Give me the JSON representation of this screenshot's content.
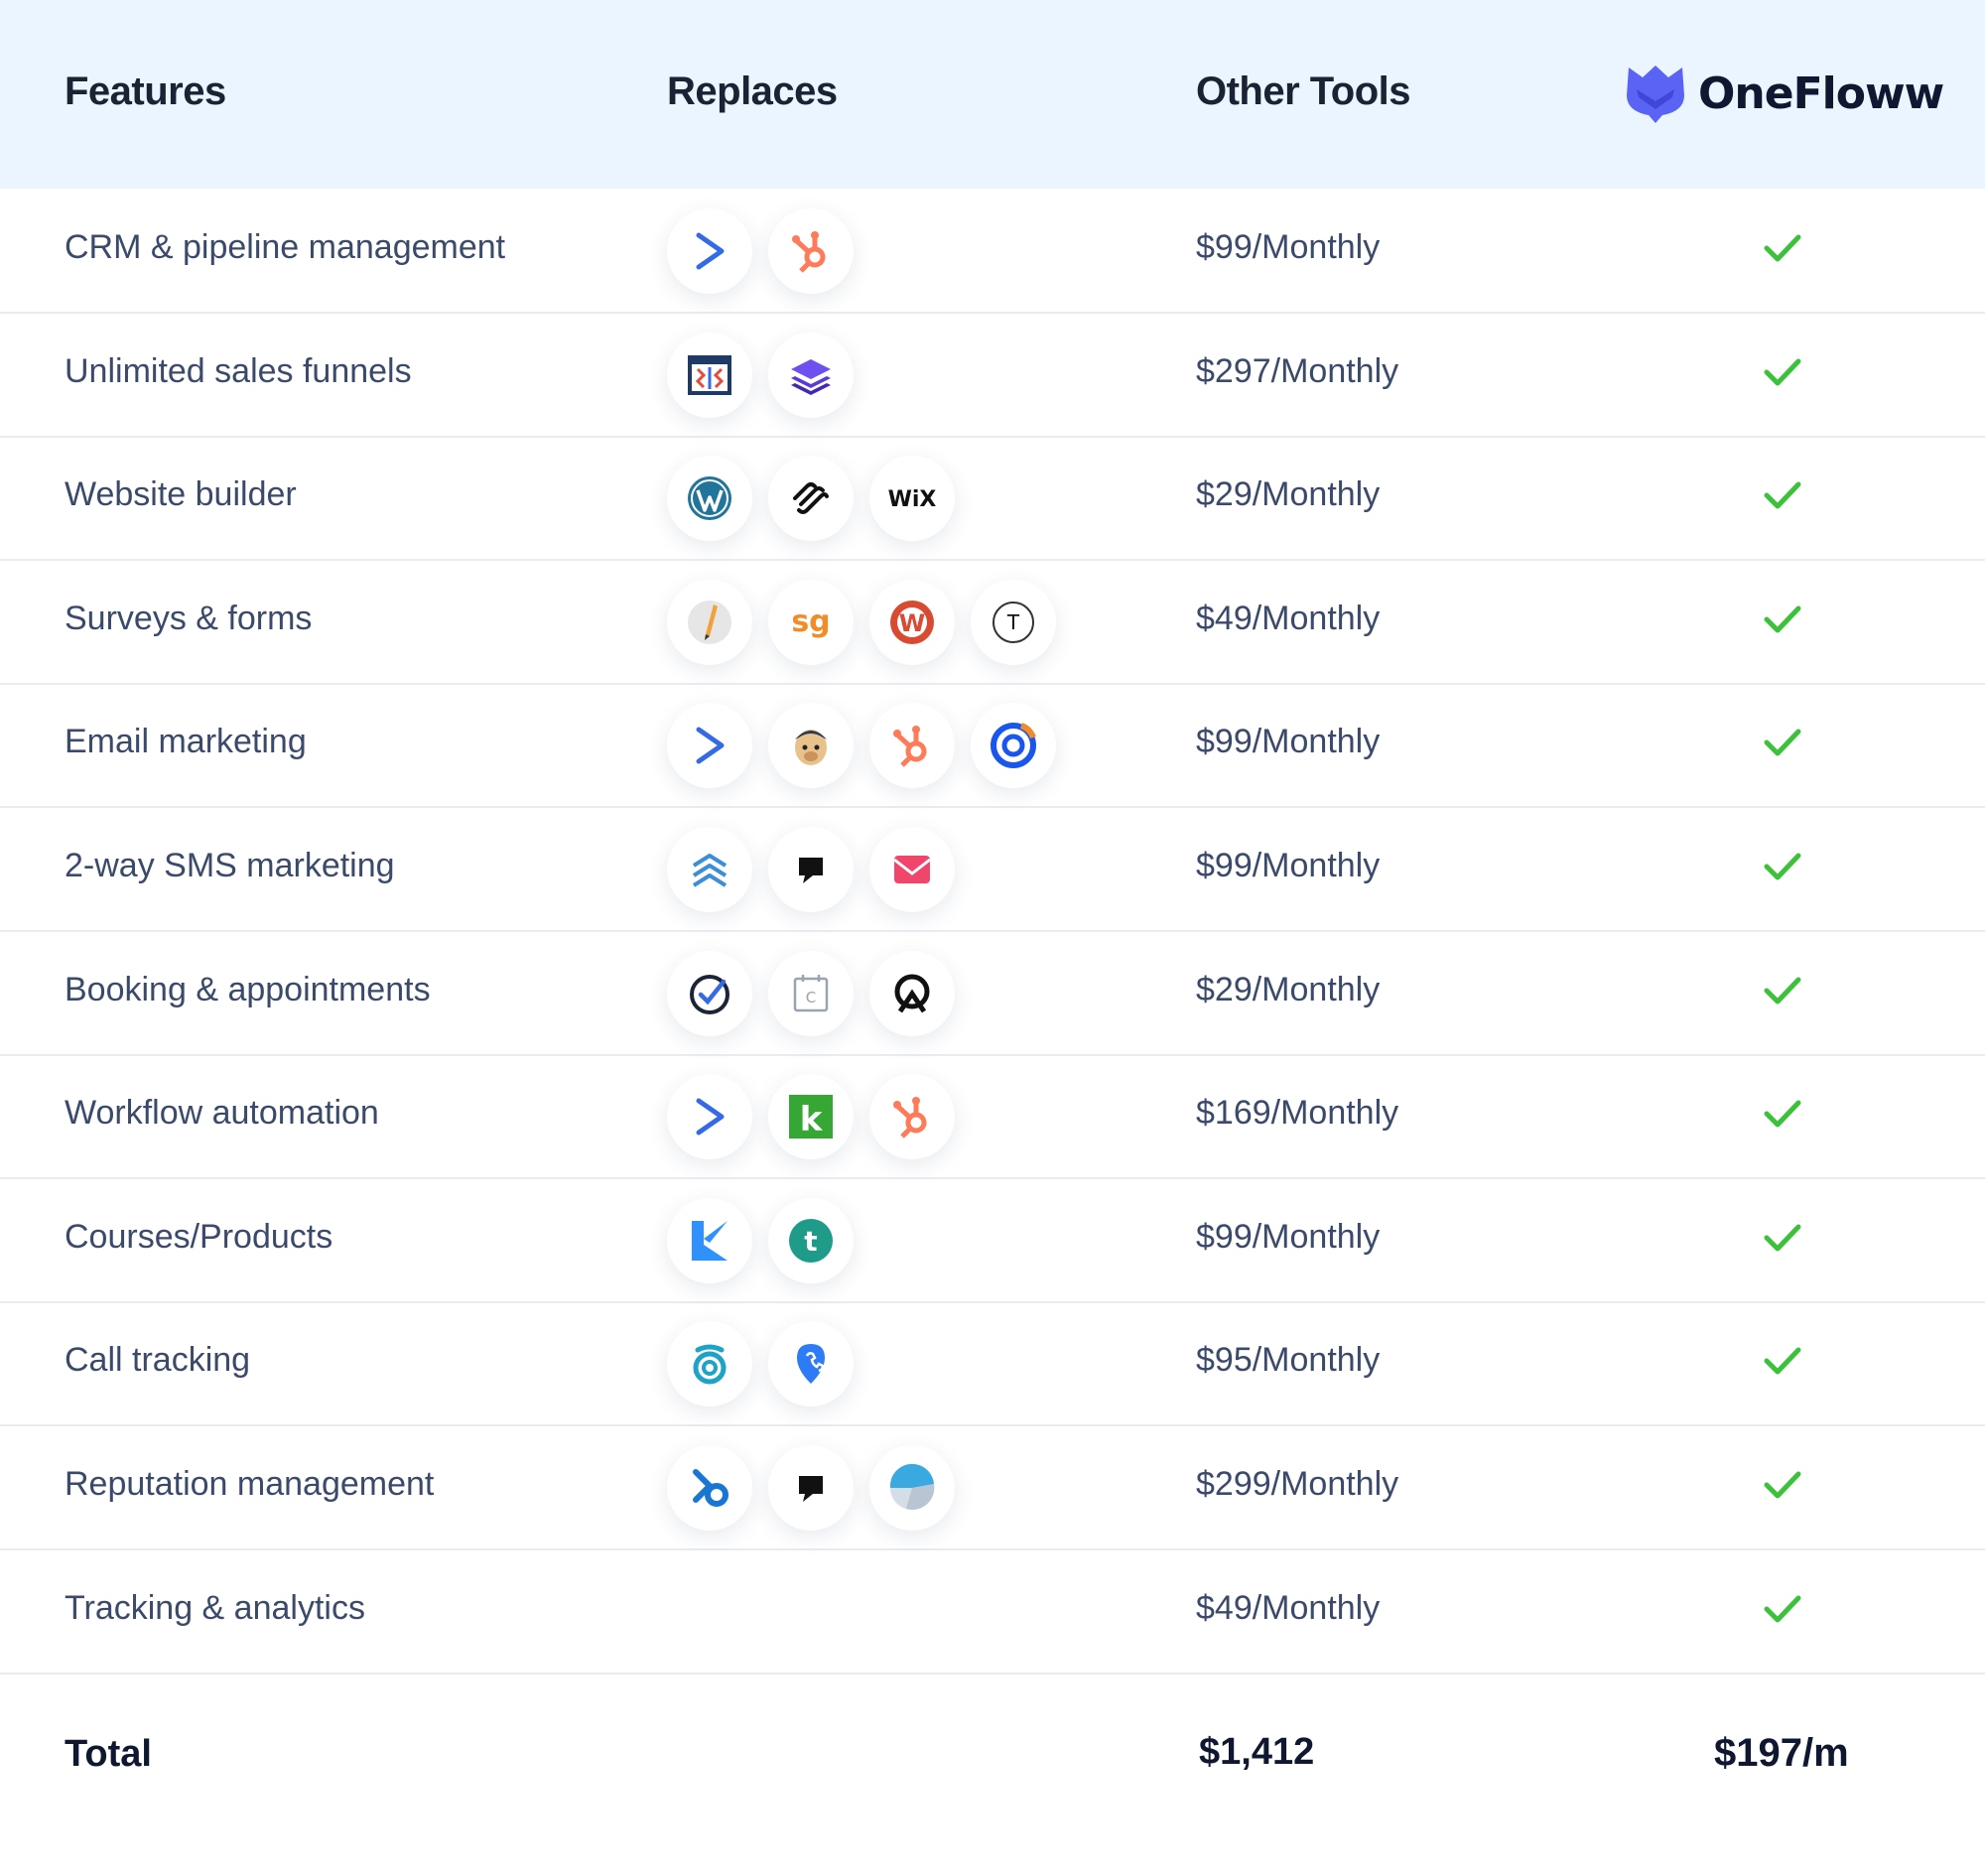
{
  "header": {
    "features": "Features",
    "replaces": "Replaces",
    "other_tools": "Other Tools",
    "brand": "OneFloww"
  },
  "colors": {
    "header_bg": "#eaf5ff",
    "check": "#3cc13b",
    "brand_logo": "#5b63f5"
  },
  "rows": [
    {
      "feature": "CRM & pipeline management",
      "price": "$99/Monthly",
      "logos": [
        "activecampaign-icon",
        "hubspot-icon"
      ]
    },
    {
      "feature": "Unlimited sales funnels",
      "price": "$297/Monthly",
      "logos": [
        "clickfunnels-icon",
        "layers-stack-icon"
      ]
    },
    {
      "feature": "Website builder",
      "price": "$29/Monthly",
      "logos": [
        "wordpress-icon",
        "squarespace-icon",
        "wix-icon"
      ]
    },
    {
      "feature": "Surveys & forms",
      "price": "$49/Monthly",
      "logos": [
        "pencil-form-icon",
        "surveygizmo-icon",
        "wufoo-icon",
        "typeform-icon"
      ]
    },
    {
      "feature": "Email marketing",
      "price": "$99/Monthly",
      "logos": [
        "activecampaign-icon",
        "mailchimp-icon",
        "hubspot-icon",
        "constant-contact-icon"
      ]
    },
    {
      "feature": "2-way SMS marketing",
      "price": "$99/Monthly",
      "logos": [
        "chevrons-up-icon",
        "podium-icon",
        "envelope-icon"
      ]
    },
    {
      "feature": "Booking & appointments",
      "price": "$29/Monthly",
      "logos": [
        "check-circle-icon",
        "calendar-icon",
        "acuity-icon"
      ]
    },
    {
      "feature": "Workflow automation",
      "price": "$169/Monthly",
      "logos": [
        "activecampaign-icon",
        "keap-icon",
        "hubspot-icon"
      ]
    },
    {
      "feature": "Courses/Products",
      "price": "$99/Monthly",
      "logos": [
        "kajabi-icon",
        "teachable-icon"
      ]
    },
    {
      "feature": "Call tracking",
      "price": "$95/Monthly",
      "logos": [
        "callrail-icon",
        "location-pin-icon"
      ]
    },
    {
      "feature": "Reputation management",
      "price": "$299/Monthly",
      "logos": [
        "birdeye-icon",
        "podium-icon",
        "yext-icon"
      ]
    },
    {
      "feature": "Tracking & analytics",
      "price": "$49/Monthly",
      "logos": []
    }
  ],
  "total": {
    "label": "Total",
    "other": "$1,412",
    "ours": "$197/m"
  },
  "logo_text": {
    "wix": "WiX",
    "surveygizmo": "sg",
    "wufoo": "W",
    "typeform": "T",
    "keap": "k",
    "teachable": "t",
    "calendar": "C"
  }
}
